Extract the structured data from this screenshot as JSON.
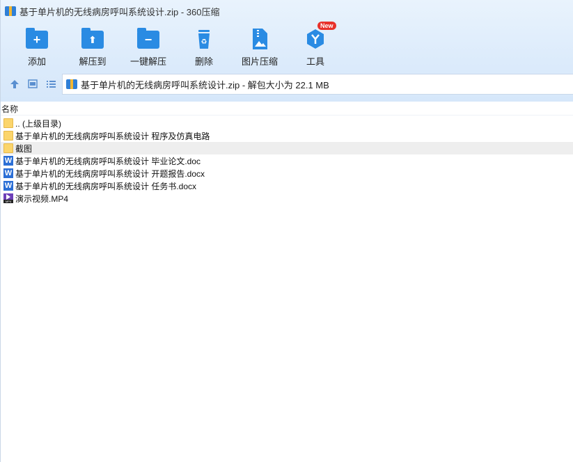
{
  "window": {
    "title": "基于单片机的无线病房呼叫系统设计.zip - 360压缩"
  },
  "toolbar": {
    "items": [
      {
        "label": "添加",
        "icon": "add-folder-icon"
      },
      {
        "label": "解压到",
        "icon": "extract-to-icon"
      },
      {
        "label": "一键解压",
        "icon": "one-click-extract-icon"
      },
      {
        "label": "删除",
        "icon": "recycle-bin-icon"
      },
      {
        "label": "图片压缩",
        "icon": "image-compress-icon"
      },
      {
        "label": "工具",
        "icon": "tools-icon",
        "badge": "New"
      }
    ]
  },
  "nav": {
    "address": "基于单片机的无线病房呼叫系统设计.zip - 解包大小为 22.1 MB"
  },
  "list": {
    "column_name": "名称",
    "files": [
      {
        "name": ".. (上级目录)",
        "type": "folder"
      },
      {
        "name": "基于单片机的无线病房呼叫系统设计 程序及仿真电路",
        "type": "folder"
      },
      {
        "name": "截图",
        "type": "folder",
        "selected": true
      },
      {
        "name": "基于单片机的无线病房呼叫系统设计 毕业论文.doc",
        "type": "word"
      },
      {
        "name": "基于单片机的无线病房呼叫系统设计 开题报告.docx",
        "type": "word"
      },
      {
        "name": "基于单片机的无线病房呼叫系统设计 任务书.docx",
        "type": "word"
      },
      {
        "name": "演示视频.MP4",
        "type": "video"
      }
    ]
  },
  "colors": {
    "accent": "#2a8be3",
    "folder": "#fbd56c",
    "word": "#2b6fd6",
    "badge": "#e8312a",
    "selected_row": "#eeeeee"
  }
}
